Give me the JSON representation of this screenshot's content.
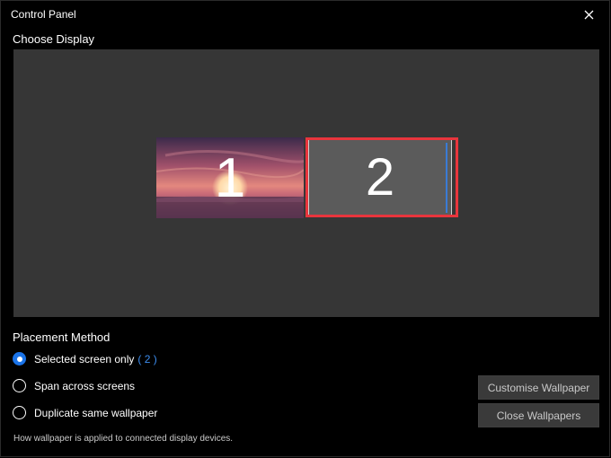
{
  "window": {
    "title": "Control Panel"
  },
  "choose_display": {
    "label": "Choose Display",
    "monitors": [
      {
        "number": "1",
        "wallpaper": "sunset-over-sea"
      },
      {
        "number": "2",
        "selected": true
      }
    ],
    "colors": {
      "selected_outline": "#e8353d",
      "area_bg": "#363636"
    }
  },
  "placement": {
    "label": "Placement Method",
    "options": [
      {
        "label": "Selected screen only",
        "badge": "( 2 )",
        "checked": true
      },
      {
        "label": "Span across screens",
        "checked": false
      },
      {
        "label": "Duplicate same wallpaper",
        "checked": false
      }
    ],
    "note": "How wallpaper is applied to connected display devices."
  },
  "buttons": {
    "customise": "Customise Wallpaper",
    "close": "Close Wallpapers"
  },
  "accent_color": "#1a73e8"
}
